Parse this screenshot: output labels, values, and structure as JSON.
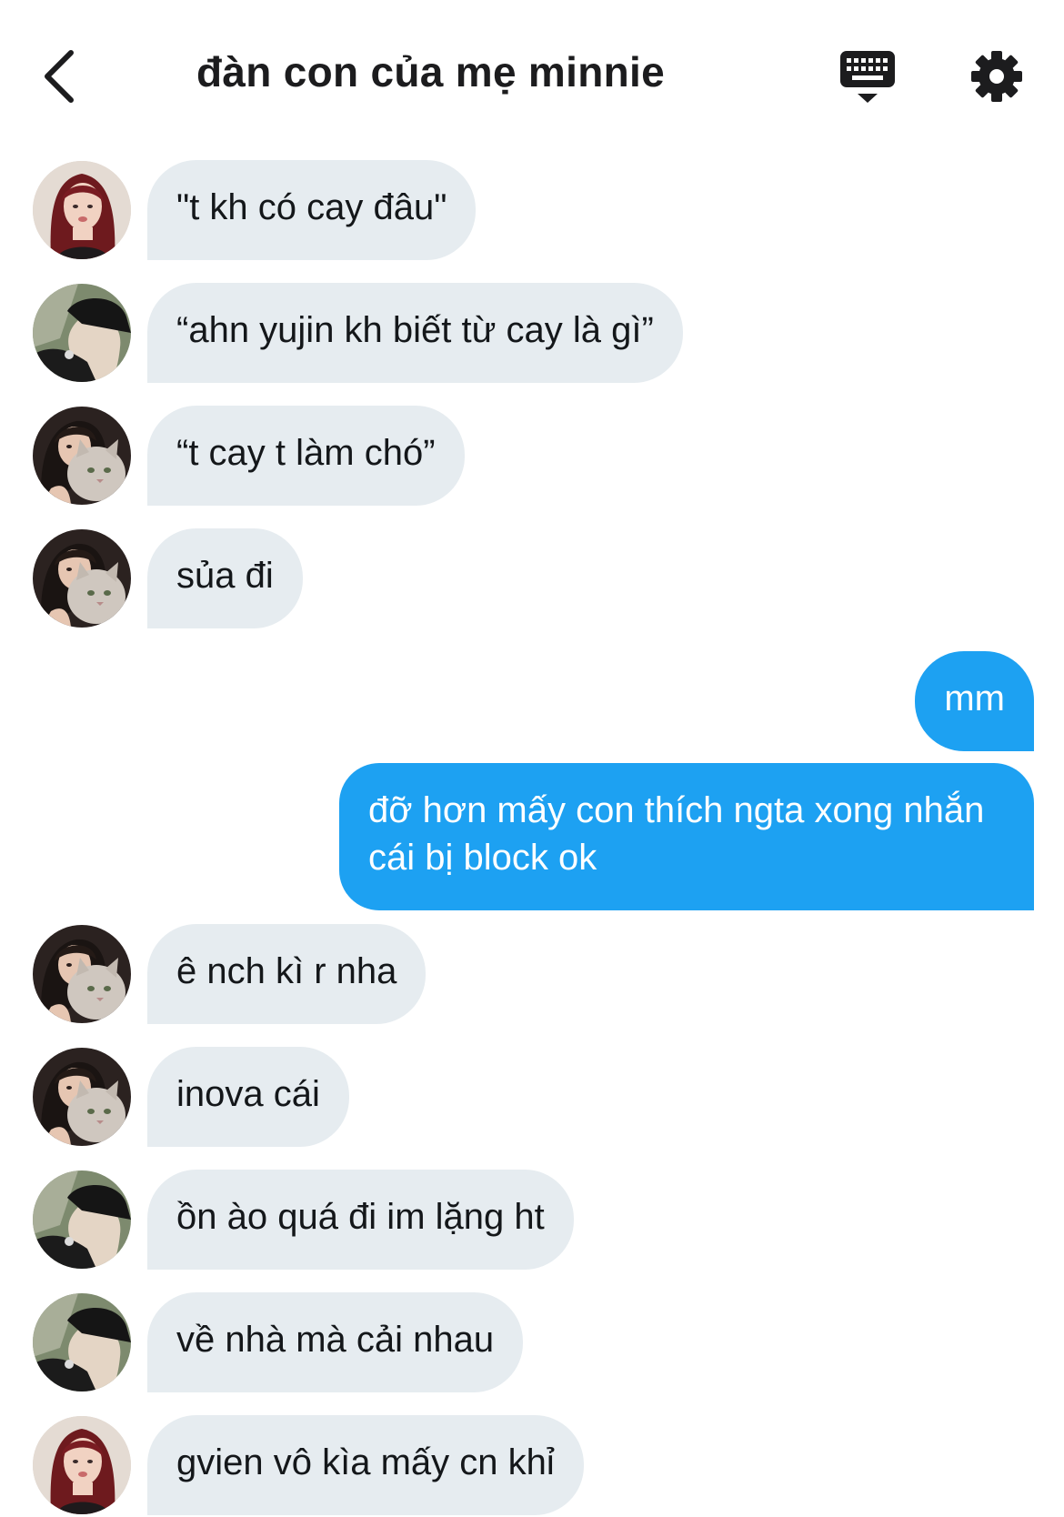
{
  "header": {
    "title": "đàn con của mẹ minnie",
    "back_icon": "chevron-left-icon",
    "keyboard_icon": "keyboard-icon",
    "settings_icon": "gear-icon"
  },
  "colors": {
    "incoming_bubble": "#e6ecf0",
    "outgoing_bubble": "#1da1f2",
    "outgoing_text": "#ffffff",
    "incoming_text": "#14171a"
  },
  "messages": [
    {
      "direction": "in",
      "sender_avatar": "avatar-red-hair",
      "text": "\"t kh có cay đâu\""
    },
    {
      "direction": "in",
      "sender_avatar": "avatar-cap",
      "text": "“ahn yujin kh biết từ cay là gì”"
    },
    {
      "direction": "in",
      "sender_avatar": "avatar-cat",
      "text": "“t cay t làm chó”"
    },
    {
      "direction": "in",
      "sender_avatar": "avatar-cat",
      "text": "sủa đi"
    },
    {
      "direction": "out",
      "text": "mm"
    },
    {
      "direction": "out",
      "text": "đỡ hơn mấy con thích ngta xong nhắn cái bị block ok"
    },
    {
      "direction": "in",
      "sender_avatar": "avatar-cat",
      "text": "ê nch kì r nha"
    },
    {
      "direction": "in",
      "sender_avatar": "avatar-cat",
      "text": "inova cái"
    },
    {
      "direction": "in",
      "sender_avatar": "avatar-cap",
      "text": "ồn ào quá đi im lặng ht"
    },
    {
      "direction": "in",
      "sender_avatar": "avatar-cap",
      "text": "về nhà mà cải nhau"
    },
    {
      "direction": "in",
      "sender_avatar": "avatar-red-hair",
      "text": "gvien vô kìa mấy cn khỉ"
    }
  ]
}
